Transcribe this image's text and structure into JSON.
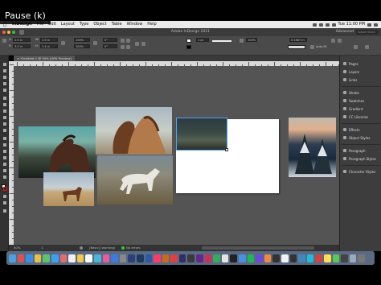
{
  "overlay": {
    "pause_label": "Pause (k)"
  },
  "menubar": {
    "app_name": "InDesign",
    "items": [
      "File",
      "Edit",
      "Layout",
      "Type",
      "Object",
      "Table",
      "Window",
      "Help"
    ],
    "clock": "Tue 11:00 PM"
  },
  "window": {
    "title": "Adobe InDesign 2021",
    "workspace": "Advanced",
    "search_placeholder": "Adobe Stock"
  },
  "control": {
    "x_value": "2.5 in",
    "y_value": "3.5 in",
    "w_value": "1.9 in",
    "h_value": "1.4 in",
    "scale_x": "100%",
    "scale_y": "100%",
    "rotate": "0°",
    "shear": "0°",
    "stroke_weight": "1 pt",
    "ref_size": "0.1667 in",
    "zoom_field": "100%",
    "autofit_label": "Auto-Fit"
  },
  "document": {
    "tab_label": "*Untitled-1 @ 50% [GPU Preview]"
  },
  "panels": {
    "items": [
      {
        "label": "Pages",
        "icon": "pages-icon"
      },
      {
        "label": "Layers",
        "icon": "layers-icon"
      },
      {
        "label": "Links",
        "icon": "links-icon"
      },
      {
        "label": "Stroke",
        "icon": "stroke-icon"
      },
      {
        "label": "Swatches",
        "icon": "swatches-icon"
      },
      {
        "label": "Gradient",
        "icon": "gradient-icon"
      },
      {
        "label": "CC Libraries",
        "icon": "cc-libraries-icon"
      },
      {
        "label": "Effects",
        "icon": "effects-icon"
      },
      {
        "label": "Object Styles",
        "icon": "object-styles-icon"
      },
      {
        "label": "Paragraph",
        "icon": "paragraph-icon"
      },
      {
        "label": "Paragraph Styles",
        "icon": "paragraph-styles-icon"
      },
      {
        "label": "Character Styles",
        "icon": "character-styles-icon"
      }
    ]
  },
  "status": {
    "zoom": "50%",
    "page": "1",
    "preflight_profile": "[Basic] (working)",
    "errors": "No errors"
  }
}
